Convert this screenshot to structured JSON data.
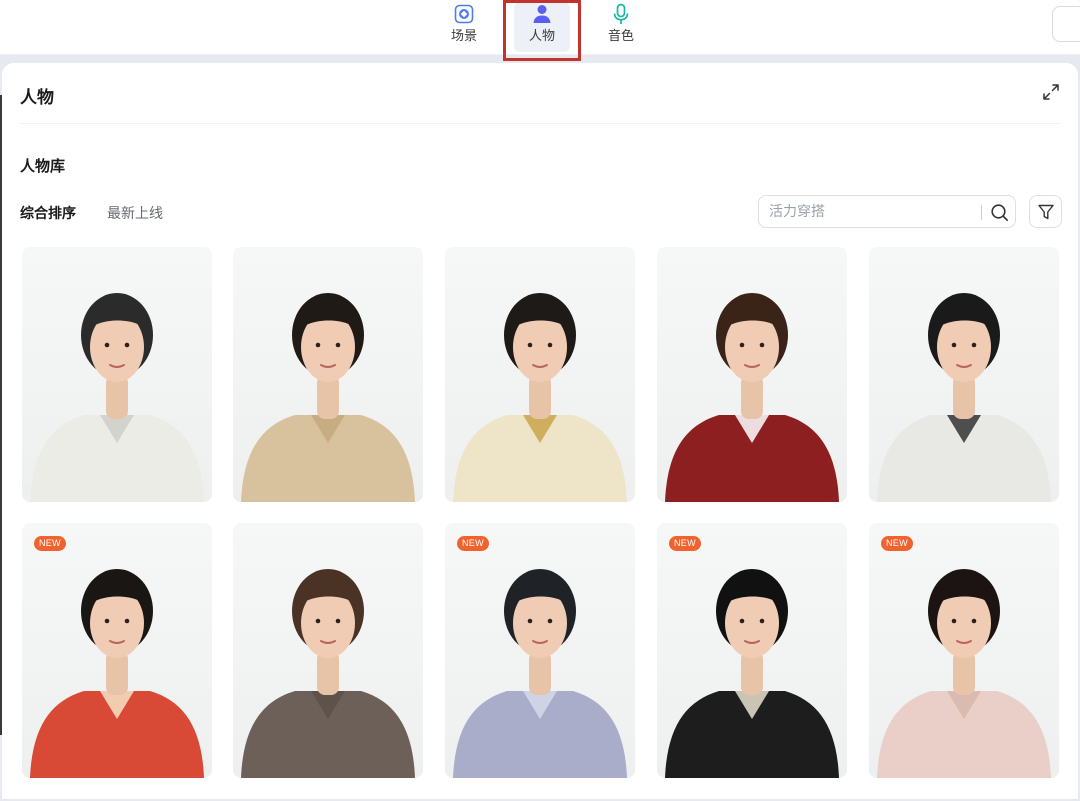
{
  "tabs": [
    {
      "label": "场景",
      "icon": "scene-icon"
    },
    {
      "label": "人物",
      "icon": "person-icon",
      "active": true
    },
    {
      "label": "音色",
      "icon": "microphone-icon"
    }
  ],
  "panel": {
    "title": "人物",
    "library_title": "人物库",
    "sort_tabs": [
      "综合排序",
      "最新上线"
    ],
    "search_placeholder": "活力穿搭"
  },
  "characters": [
    {
      "badge": "",
      "outfit": "#ecece6",
      "hair": "#2b2b2b",
      "accent": "#cfcfc8"
    },
    {
      "badge": "",
      "outfit": "#d8c29e",
      "hair": "#201a17",
      "accent": "#c3a97c"
    },
    {
      "badge": "",
      "outfit": "#eee4c8",
      "hair": "#1d1a18",
      "accent": "#c9a44a"
    },
    {
      "badge": "",
      "outfit": "#8e1f21",
      "hair": "#3a2418",
      "accent": "#ffffff"
    },
    {
      "badge": "",
      "outfit": "#e8e8e4",
      "hair": "#1a1a1a",
      "accent": "#333333"
    },
    {
      "badge": "NEW",
      "outfit": "#d94a36",
      "hair": "#1a1614",
      "accent": "#f4e3c4"
    },
    {
      "badge": "",
      "outfit": "#6d6058",
      "hair": "#4a3224",
      "accent": "#5c5049"
    },
    {
      "badge": "NEW",
      "outfit": "#a9adc9",
      "hair": "#1f2226",
      "accent": "#d7d9ea"
    },
    {
      "badge": "NEW",
      "outfit": "#1d1d1d",
      "hair": "#111111",
      "accent": "#e8e2cf"
    },
    {
      "badge": "NEW",
      "outfit": "#e9cfc7",
      "hair": "#1b1412",
      "accent": "#d8b6aa"
    }
  ],
  "colors": {
    "accent": "#5b5ff0",
    "badge": "#f0632e",
    "highlight_box": "#c2322f"
  }
}
